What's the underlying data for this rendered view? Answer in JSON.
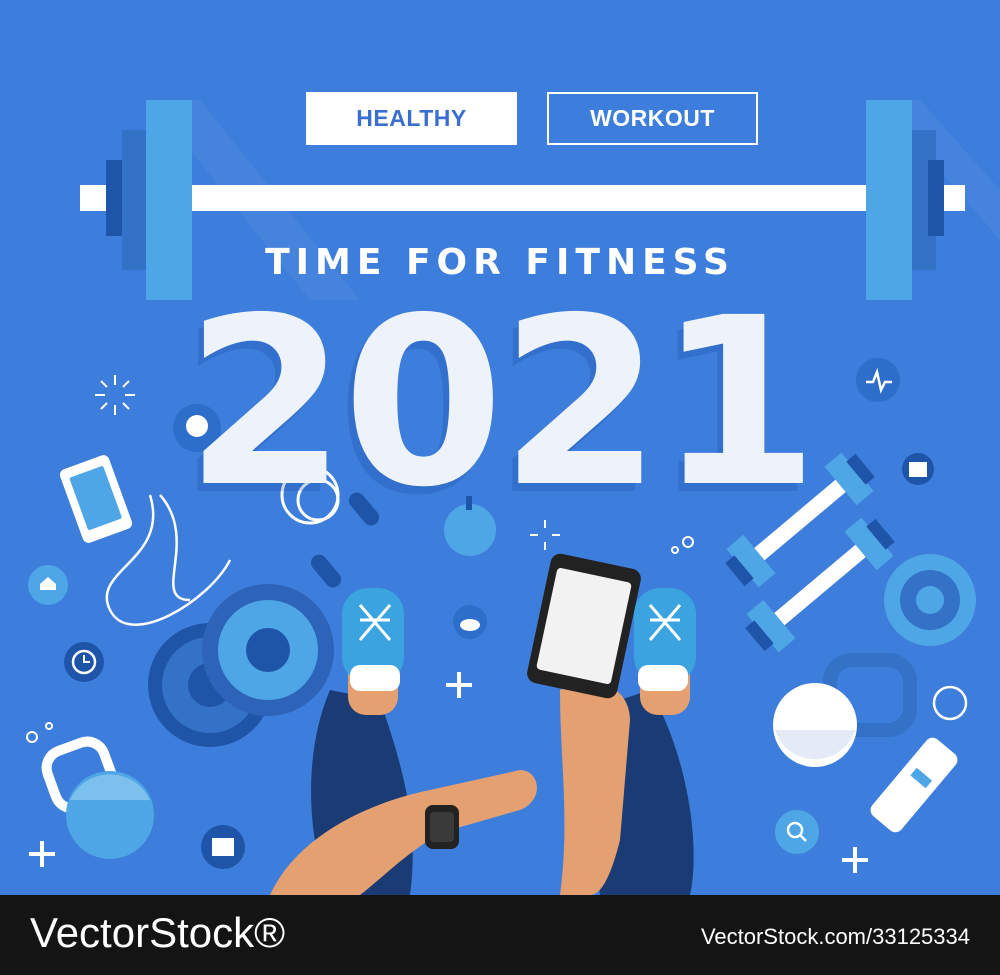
{
  "tags": {
    "healthy": "HEALTHY",
    "workout": "WORKOUT"
  },
  "headline": "TIME FOR FITNESS",
  "year": "2021",
  "footer": {
    "brand": "VectorStock®",
    "image_id": "VectorStock.com/33125334"
  },
  "colors": {
    "background": "#3d7ddb",
    "plate_light": "#4fa6e6",
    "plate_dark": "#1f55a8",
    "bar": "#ffffff",
    "shoe": "#3aa3e0",
    "skin": "#e4a071",
    "shorts": "#1a3b74",
    "footer": "#141414"
  },
  "icons": [
    "heartbeat-icon",
    "calendar-icon",
    "chat-icon",
    "home-icon",
    "clock-icon",
    "cloud-icon",
    "map-pin-icon",
    "search-icon",
    "plus-icon",
    "sparkle-icon"
  ]
}
